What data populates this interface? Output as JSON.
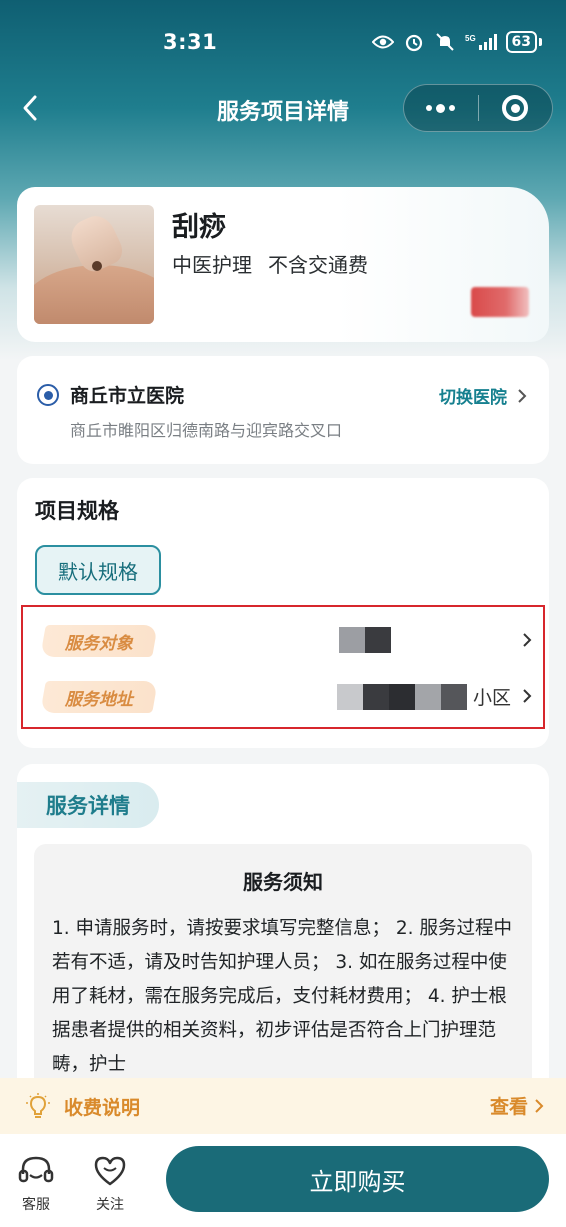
{
  "status_bar": {
    "time": "3:31",
    "battery": "63",
    "network": "5G"
  },
  "nav": {
    "title": "服务项目详情"
  },
  "product": {
    "name": "刮痧",
    "tags": [
      "中医护理",
      "不含交通费"
    ]
  },
  "hospital": {
    "name": "商丘市立医院",
    "switch_label": "切换医院",
    "address": "商丘市睢阳区归德南路与迎宾路交叉口"
  },
  "spec": {
    "title": "项目规格",
    "selected": "默认规格",
    "rows": [
      {
        "label": "服务对象",
        "value": ""
      },
      {
        "label": "服务地址",
        "value": "小区"
      }
    ]
  },
  "detail": {
    "tab": "服务详情",
    "notice_title": "服务须知",
    "notice_text": "1.  申请服务时，请按要求填写完整信息；  2.  服务过程中若有不适，请及时告知护理人员；  3.  如在服务过程中使用了耗材，需在服务完成后，支付耗材费用；  4.  护士根据患者提供的相关资料，初步评估是否符合上门护理范畴，护士"
  },
  "fee": {
    "label": "收费说明",
    "view": "查看"
  },
  "bottom": {
    "service": "客服",
    "follow": "关注",
    "buy": "立即购买"
  },
  "colors": {
    "primary": "#1a6b78",
    "accent_orange": "#d98a2b",
    "highlight_red": "#d7262c"
  }
}
